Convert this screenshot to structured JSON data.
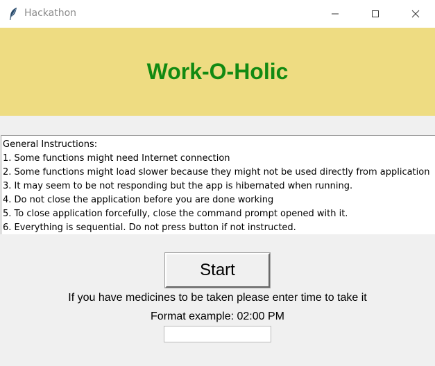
{
  "window": {
    "title": "Hackathon",
    "icon": "feather-icon",
    "controls": [
      "minimize-icon",
      "maximize-icon",
      "close-icon"
    ]
  },
  "header": {
    "heading": "Work-O-Holic",
    "background_color": "#eedc82",
    "text_color": "#128a12"
  },
  "instructions": {
    "lines": [
      "General Instructions:",
      "1. Some functions might need Internet connection",
      "2. Some functions might load slower because they might not be used directly from application",
      "3. It may seem to be not responding but the app is hibernated when running.",
      "4. Do not close the application before you are done working",
      "5. To close application forcefully, close the command prompt opened with it.",
      "6. Everything is sequential. Do not press button if not instructed."
    ]
  },
  "main": {
    "start_label": "Start",
    "medicine_prompt": "If you have medicines to be taken please enter time to take it",
    "format_example": "Format example: 02:00 PM",
    "time_input_value": ""
  }
}
